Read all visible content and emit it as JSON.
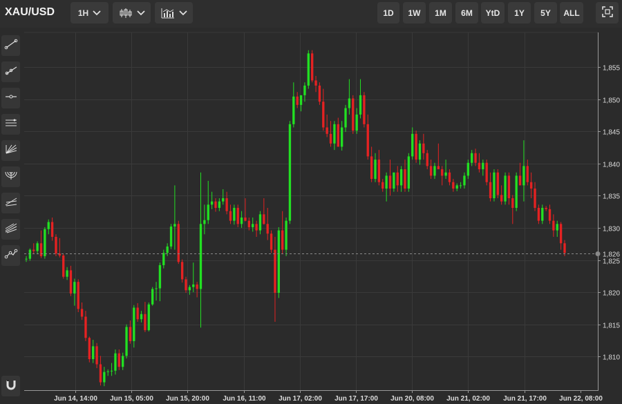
{
  "header": {
    "symbol": "XAU/USD",
    "interval_label": "1H",
    "chart_type_icon": "candlestick-icon",
    "indicators_icon": "indicators-icon",
    "ranges": [
      "1D",
      "1W",
      "1M",
      "6M",
      "YtD",
      "1Y",
      "5Y",
      "ALL"
    ],
    "fullscreen_icon": "fullscreen-icon"
  },
  "tools": [
    {
      "name": "trend-line-icon"
    },
    {
      "name": "ray-icon"
    },
    {
      "name": "horizontal-line-icon"
    },
    {
      "name": "parallel-channel-icon"
    },
    {
      "name": "fan-icon"
    },
    {
      "name": "arc-icon"
    },
    {
      "name": "fib-retracement-icon"
    },
    {
      "name": "pitchfork-icon"
    },
    {
      "name": "path-icon"
    },
    {
      "name": "magnet-icon"
    }
  ],
  "colors": {
    "up": "#22e022",
    "down": "#e52222",
    "background": "#2b2b2b",
    "grid": "#3a3a3a"
  },
  "chart_data": {
    "type": "candlestick",
    "ylim": [
      1805,
      1858
    ],
    "y_ticks": [
      1810,
      1815,
      1820,
      1825,
      1830,
      1835,
      1840,
      1845,
      1850,
      1855
    ],
    "last_price": 1826,
    "last_price_label": "1,826",
    "x_ticks": [
      "Jun 14, 14:00",
      "Jun 15, 05:00",
      "Jun 15, 20:00",
      "Jun 16, 11:00",
      "Jun 17, 02:00",
      "Jun 17, 17:00",
      "Jun 20, 08:00",
      "Jun 21, 02:00",
      "Jun 21, 17:00",
      "Jun 22, 08:00"
    ],
    "candles": [
      [
        1825.1,
        1825.6,
        1824.7,
        1825.2
      ],
      [
        1825.2,
        1826.8,
        1824.9,
        1826.6
      ],
      [
        1826.6,
        1827.6,
        1826.0,
        1826.4
      ],
      [
        1826.4,
        1827.9,
        1825.9,
        1827.6
      ],
      [
        1827.6,
        1829.6,
        1825.3,
        1825.6
      ],
      [
        1825.6,
        1830.1,
        1825.2,
        1829.8
      ],
      [
        1829.8,
        1831.3,
        1829.0,
        1830.9
      ],
      [
        1830.9,
        1831.6,
        1828.0,
        1828.6
      ],
      [
        1828.6,
        1829.0,
        1825.6,
        1826.0
      ],
      [
        1826.0,
        1828.4,
        1825.4,
        1825.7
      ],
      [
        1825.7,
        1825.9,
        1822.1,
        1822.4
      ],
      [
        1822.4,
        1823.9,
        1821.9,
        1823.4
      ],
      [
        1823.4,
        1824.1,
        1819.4,
        1819.8
      ],
      [
        1819.8,
        1822.1,
        1817.9,
        1821.6
      ],
      [
        1821.6,
        1822.0,
        1816.9,
        1817.4
      ],
      [
        1817.4,
        1818.4,
        1815.7,
        1816.2
      ],
      [
        1816.2,
        1817.1,
        1812.4,
        1812.9
      ],
      [
        1812.9,
        1813.1,
        1809.1,
        1809.6
      ],
      [
        1809.6,
        1812.6,
        1809.0,
        1811.6
      ],
      [
        1811.6,
        1812.1,
        1808.2,
        1808.8
      ],
      [
        1808.8,
        1810.1,
        1805.5,
        1806.0
      ],
      [
        1806.0,
        1808.4,
        1805.4,
        1807.6
      ],
      [
        1807.6,
        1808.0,
        1807.0,
        1807.7
      ],
      [
        1807.7,
        1809.0,
        1807.0,
        1807.8
      ],
      [
        1807.8,
        1811.1,
        1807.2,
        1810.5
      ],
      [
        1810.5,
        1811.1,
        1807.9,
        1808.4
      ],
      [
        1808.4,
        1810.6,
        1807.9,
        1810.1
      ],
      [
        1810.1,
        1815.0,
        1809.7,
        1814.6
      ],
      [
        1814.6,
        1815.6,
        1812.0,
        1812.4
      ],
      [
        1812.4,
        1818.0,
        1811.4,
        1817.6
      ],
      [
        1817.6,
        1818.3,
        1815.4,
        1815.8
      ],
      [
        1815.8,
        1817.1,
        1815.3,
        1816.6
      ],
      [
        1816.6,
        1818.5,
        1813.8,
        1814.1
      ],
      [
        1814.1,
        1818.4,
        1813.9,
        1818.1
      ],
      [
        1818.1,
        1820.8,
        1817.9,
        1820.5
      ],
      [
        1820.5,
        1821.6,
        1818.7,
        1820.6
      ],
      [
        1820.6,
        1824.6,
        1818.6,
        1824.2
      ],
      [
        1824.2,
        1826.6,
        1823.7,
        1826.1
      ],
      [
        1826.1,
        1827.6,
        1825.6,
        1827.1
      ],
      [
        1827.1,
        1830.6,
        1826.7,
        1830.2
      ],
      [
        1830.2,
        1836.6,
        1826.6,
        1830.6
      ],
      [
        1830.6,
        1831.1,
        1824.4,
        1824.7
      ],
      [
        1824.7,
        1825.1,
        1821.5,
        1822.0
      ],
      [
        1822.0,
        1822.4,
        1819.9,
        1820.3
      ],
      [
        1820.3,
        1821.1,
        1819.6,
        1820.8
      ],
      [
        1820.8,
        1824.6,
        1820.0,
        1821.2
      ],
      [
        1821.2,
        1821.6,
        1819.2,
        1820.5
      ],
      [
        1820.5,
        1838.6,
        1814.5,
        1830.6
      ],
      [
        1830.6,
        1833.6,
        1829.0,
        1831.2
      ],
      [
        1831.2,
        1837.3,
        1830.6,
        1833.6
      ],
      [
        1833.6,
        1835.6,
        1832.9,
        1834.1
      ],
      [
        1834.1,
        1834.6,
        1832.5,
        1833.1
      ],
      [
        1833.1,
        1834.6,
        1832.6,
        1834.1
      ],
      [
        1834.1,
        1836.0,
        1833.6,
        1834.6
      ],
      [
        1834.6,
        1835.6,
        1832.1,
        1832.6
      ],
      [
        1832.6,
        1833.6,
        1830.6,
        1831.1
      ],
      [
        1831.1,
        1833.6,
        1830.5,
        1833.1
      ],
      [
        1833.1,
        1833.6,
        1830.1,
        1830.6
      ],
      [
        1830.6,
        1832.6,
        1830.0,
        1831.6
      ],
      [
        1831.6,
        1834.6,
        1831.0,
        1831.1
      ],
      [
        1831.1,
        1831.6,
        1829.6,
        1830.1
      ],
      [
        1830.1,
        1831.6,
        1829.4,
        1830.6
      ],
      [
        1830.6,
        1831.1,
        1828.6,
        1829.6
      ],
      [
        1829.6,
        1832.6,
        1829.0,
        1832.1
      ],
      [
        1832.1,
        1834.6,
        1830.5,
        1830.6
      ],
      [
        1830.6,
        1833.1,
        1828.1,
        1829.1
      ],
      [
        1829.1,
        1829.6,
        1826.1,
        1826.6
      ],
      [
        1826.6,
        1828.6,
        1815.4,
        1819.9
      ],
      [
        1819.9,
        1830.1,
        1819.1,
        1829.6
      ],
      [
        1829.6,
        1832.6,
        1825.9,
        1826.6
      ],
      [
        1826.6,
        1831.6,
        1825.6,
        1831.1
      ],
      [
        1831.1,
        1846.6,
        1830.6,
        1846.1
      ],
      [
        1846.1,
        1852.6,
        1845.6,
        1850.4
      ],
      [
        1850.4,
        1851.1,
        1848.6,
        1849.1
      ],
      [
        1849.1,
        1850.6,
        1848.1,
        1850.6
      ],
      [
        1850.6,
        1852.6,
        1849.6,
        1852.1
      ],
      [
        1852.1,
        1857.6,
        1851.6,
        1857.1
      ],
      [
        1857.1,
        1857.6,
        1852.6,
        1852.9
      ],
      [
        1852.9,
        1853.6,
        1851.1,
        1852.1
      ],
      [
        1852.1,
        1852.6,
        1849.1,
        1849.6
      ],
      [
        1849.6,
        1851.6,
        1845.1,
        1845.6
      ],
      [
        1845.6,
        1847.6,
        1844.1,
        1844.6
      ],
      [
        1844.6,
        1846.6,
        1842.6,
        1843.1
      ],
      [
        1843.1,
        1846.6,
        1842.1,
        1846.1
      ],
      [
        1846.1,
        1847.1,
        1842.6,
        1842.6
      ],
      [
        1842.6,
        1846.6,
        1842.0,
        1845.6
      ],
      [
        1845.6,
        1849.1,
        1844.9,
        1848.6
      ],
      [
        1848.6,
        1853.1,
        1847.6,
        1850.1
      ],
      [
        1850.1,
        1850.6,
        1844.6,
        1845.1
      ],
      [
        1845.1,
        1848.6,
        1844.6,
        1847.6
      ],
      [
        1847.6,
        1853.1,
        1847.0,
        1850.6
      ],
      [
        1850.6,
        1851.1,
        1845.6,
        1846.1
      ],
      [
        1846.1,
        1847.6,
        1840.6,
        1841.1
      ],
      [
        1841.1,
        1842.6,
        1837.1,
        1837.6
      ],
      [
        1837.6,
        1841.6,
        1837.1,
        1840.6
      ],
      [
        1840.6,
        1842.1,
        1836.6,
        1837.1
      ],
      [
        1837.1,
        1837.6,
        1835.6,
        1836.1
      ],
      [
        1836.1,
        1838.6,
        1834.1,
        1838.1
      ],
      [
        1838.1,
        1840.6,
        1835.0,
        1836.1
      ],
      [
        1836.1,
        1838.6,
        1835.6,
        1838.6
      ],
      [
        1838.6,
        1839.6,
        1835.6,
        1836.6
      ],
      [
        1836.6,
        1839.6,
        1835.6,
        1839.1
      ],
      [
        1839.1,
        1840.6,
        1835.6,
        1836.1
      ],
      [
        1836.1,
        1841.6,
        1835.6,
        1841.1
      ],
      [
        1841.1,
        1845.6,
        1840.6,
        1844.6
      ],
      [
        1844.6,
        1845.1,
        1840.1,
        1840.6
      ],
      [
        1840.6,
        1843.6,
        1839.8,
        1843.1
      ],
      [
        1843.1,
        1844.6,
        1840.6,
        1841.6
      ],
      [
        1841.6,
        1842.1,
        1839.1,
        1839.6
      ],
      [
        1839.6,
        1840.6,
        1837.6,
        1838.1
      ],
      [
        1838.1,
        1840.1,
        1837.6,
        1839.6
      ],
      [
        1839.6,
        1843.1,
        1839.1,
        1839.1
      ],
      [
        1839.1,
        1839.6,
        1836.6,
        1838.1
      ],
      [
        1838.1,
        1840.6,
        1837.6,
        1838.6
      ],
      [
        1838.6,
        1839.1,
        1836.6,
        1837.1
      ],
      [
        1837.1,
        1837.6,
        1835.6,
        1836.1
      ],
      [
        1836.1,
        1836.9,
        1835.7,
        1836.6
      ],
      [
        1836.6,
        1837.1,
        1836.1,
        1836.6
      ],
      [
        1836.6,
        1838.6,
        1836.1,
        1838.1
      ],
      [
        1838.1,
        1840.6,
        1837.6,
        1840.1
      ],
      [
        1840.1,
        1842.1,
        1839.6,
        1841.6
      ],
      [
        1841.6,
        1842.3,
        1839.6,
        1840.1
      ],
      [
        1840.1,
        1841.6,
        1838.6,
        1839.1
      ],
      [
        1839.1,
        1840.6,
        1838.1,
        1840.1
      ],
      [
        1840.1,
        1840.6,
        1836.6,
        1837.1
      ],
      [
        1837.1,
        1838.6,
        1834.1,
        1834.6
      ],
      [
        1834.6,
        1839.1,
        1834.1,
        1838.6
      ],
      [
        1838.6,
        1839.1,
        1834.6,
        1835.1
      ],
      [
        1835.1,
        1836.6,
        1833.6,
        1834.1
      ],
      [
        1834.1,
        1838.6,
        1833.6,
        1838.1
      ],
      [
        1838.1,
        1838.6,
        1833.6,
        1834.6
      ],
      [
        1834.6,
        1835.1,
        1830.6,
        1833.1
      ],
      [
        1833.1,
        1838.6,
        1832.6,
        1838.1
      ],
      [
        1838.1,
        1840.1,
        1836.6,
        1836.6
      ],
      [
        1836.6,
        1843.6,
        1834.1,
        1839.6
      ],
      [
        1839.6,
        1840.6,
        1836.6,
        1837.1
      ],
      [
        1837.1,
        1838.6,
        1834.6,
        1836.1
      ],
      [
        1836.1,
        1837.1,
        1832.6,
        1833.1
      ],
      [
        1833.1,
        1833.6,
        1830.6,
        1831.1
      ],
      [
        1831.1,
        1833.6,
        1830.6,
        1833.1
      ],
      [
        1833.1,
        1833.4,
        1832.6,
        1832.9
      ],
      [
        1832.9,
        1833.6,
        1830.6,
        1831.1
      ],
      [
        1831.1,
        1832.1,
        1828.6,
        1829.6
      ],
      [
        1829.6,
        1831.1,
        1828.6,
        1830.6
      ],
      [
        1830.6,
        1830.9,
        1826.6,
        1827.6
      ],
      [
        1827.6,
        1828.1,
        1825.6,
        1826.1
      ]
    ]
  }
}
